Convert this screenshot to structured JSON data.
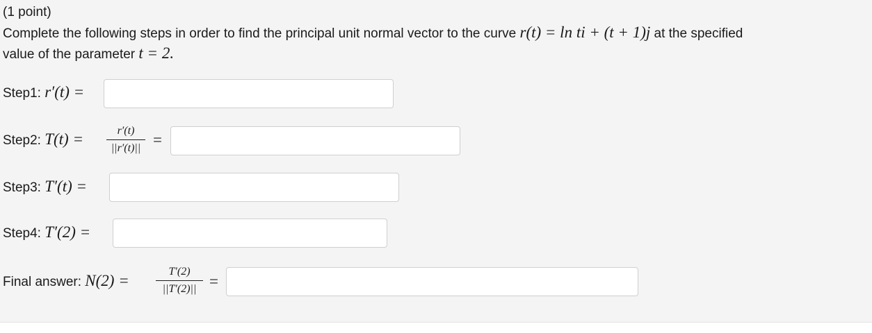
{
  "header": {
    "points": "(1 point)",
    "prompt_before": "Complete the following steps in order to find the principal unit normal vector to the curve",
    "curve_expr": "r(t) = ln ti + (t + 1)j",
    "prompt_mid": "at the specified",
    "prompt_line2": "value of the parameter",
    "param_expr": "t = 2."
  },
  "steps": [
    {
      "label": "Step1:",
      "math": "r′(t) ="
    },
    {
      "label": "Step2:",
      "math": "T(t) =",
      "frac_num": "r′(t)",
      "frac_den": "||r′(t)||",
      "eq": "="
    },
    {
      "label": "Step3:",
      "math": "T′(t) ="
    },
    {
      "label": "Step4:",
      "math": "T′(2) ="
    }
  ],
  "final": {
    "label": "Final answer:",
    "math": "N(2) =",
    "frac_num": "T′(2)",
    "frac_den": "||T′(2)||",
    "eq": "="
  },
  "inputs": {
    "step1": "",
    "step2": "",
    "step3": "",
    "step4": "",
    "final": ""
  }
}
